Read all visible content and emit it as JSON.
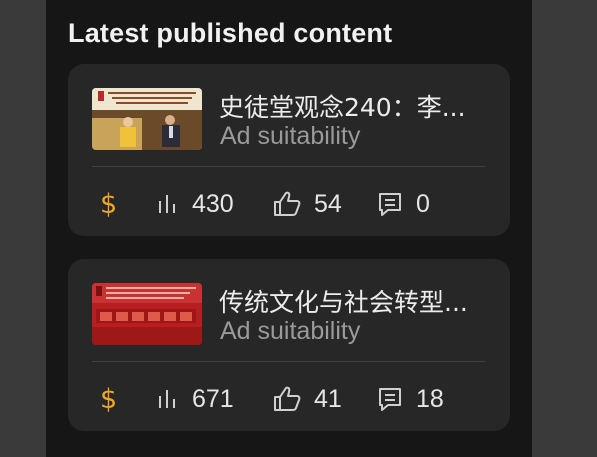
{
  "section": {
    "title": "Latest published content"
  },
  "cards": [
    {
      "title": "史徒堂观念240：李...",
      "subtitle": "Ad suitability",
      "monetization_symbol": "$",
      "views": "430",
      "likes": "54",
      "comments": "0",
      "thumbnail_icon": "video-thumbnail-lecture"
    },
    {
      "title": "传统文化与社会转型...",
      "subtitle": "Ad suitability",
      "monetization_symbol": "$",
      "views": "671",
      "likes": "41",
      "comments": "18",
      "thumbnail_icon": "video-thumbnail-red-banner"
    }
  ],
  "colors": {
    "background": "#161616",
    "card": "#272727",
    "accent_monetization": "#f0a52a",
    "text_primary": "#ececec",
    "text_secondary": "#9a9a9a"
  }
}
